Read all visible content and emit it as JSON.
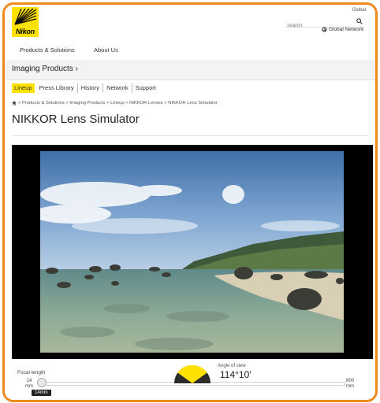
{
  "header": {
    "logo_text": "Nikon",
    "global_label": "Global",
    "search_placeholder": "Search",
    "global_network": "Global Network"
  },
  "topnav": {
    "items": [
      "Products & Solutions",
      "About Us"
    ]
  },
  "section": {
    "title": "Imaging Products",
    "chevron": "›"
  },
  "subnav": {
    "items": [
      "Lineup",
      "Press Library",
      "History",
      "Network",
      "Support"
    ],
    "active": "Lineup"
  },
  "breadcrumb": "> Products & Solutions > Imaging Products > Lineup > NIKKOR Lenses > NIKKOR Lens Simulator",
  "page_title": "NIKKOR Lens Simulator",
  "simulator": {
    "focal_length_label": "Focal length",
    "min_label": "14\nmm",
    "max_label": "800\nmm",
    "current_focal_length": "14mm",
    "slider_fraction": 0,
    "angle_label": "Angle of view",
    "angle_value": "114°10′"
  },
  "colors": {
    "accent": "#ffe100",
    "frame": "#f08a1c",
    "sim_bg": "#000000"
  },
  "icons": [
    "nikon-logo",
    "search-icon",
    "globe-icon",
    "home-icon",
    "angle-gauge-icon"
  ]
}
